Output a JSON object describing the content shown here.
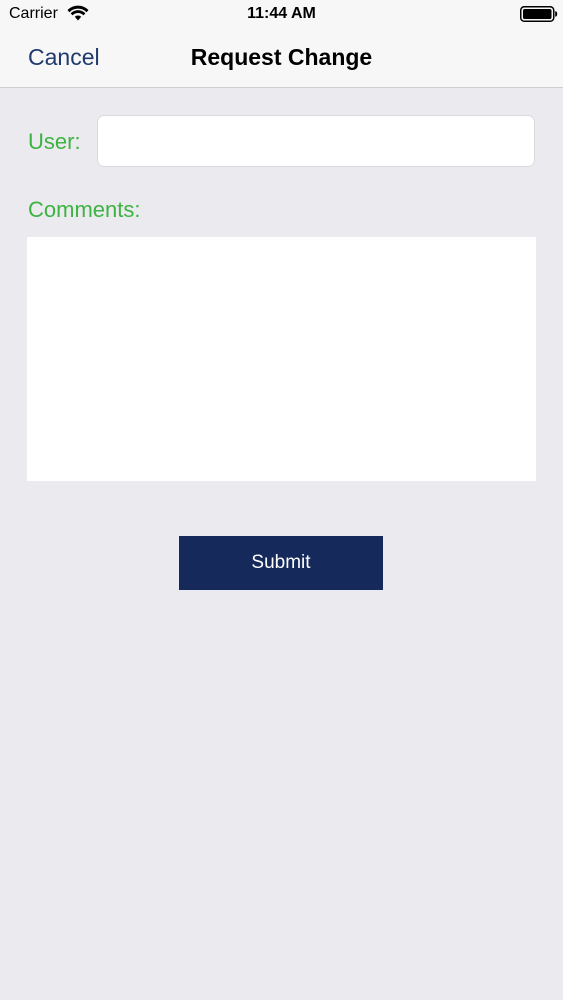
{
  "status_bar": {
    "carrier": "Carrier",
    "time": "11:44 AM",
    "wifi_icon": "wifi-icon",
    "battery_icon": "battery-icon"
  },
  "nav_bar": {
    "cancel_label": "Cancel",
    "title": "Request Change"
  },
  "form": {
    "user_label": "User:",
    "user_value": "",
    "comments_label": "Comments:",
    "comments_value": "",
    "submit_label": "Submit"
  },
  "colors": {
    "accent_nav": "#1f3a6b",
    "label_green": "#3db342",
    "submit_bg": "#15295a",
    "background": "#ebeaef"
  }
}
